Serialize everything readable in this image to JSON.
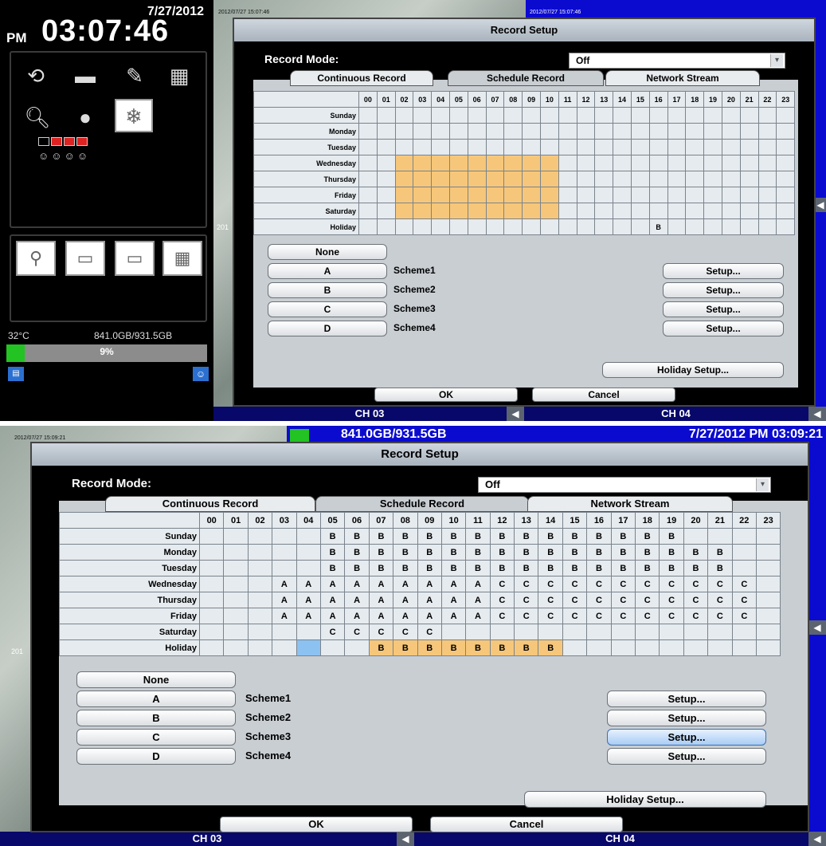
{
  "top": {
    "clock": {
      "date": "7/27/2012",
      "ampm": "PM",
      "time": "03:07:46"
    },
    "left_panel": {
      "icons": [
        "refresh-icon",
        "folder-icon",
        "tools-icon",
        "calendar-search-icon",
        "search-doc-icon",
        "camera-icon",
        "freeze-icon"
      ],
      "hdd_temp": "32°C",
      "hdd_usage": "841.0GB/931.5GB",
      "hdd_percent_label": "9%",
      "hdd_percent": 0.09
    },
    "ch_left": "CH 03",
    "ch_right": "CH 04",
    "cam_timestamp_left": "2012/07/27 15:07:46",
    "cam_timestamp_right": "2012/07/27 15:07:46",
    "cam_small": "201",
    "dialog": {
      "title": "Record Setup",
      "record_mode_label": "Record Mode:",
      "record_mode_value": "Off",
      "tabs": [
        "Continuous Record",
        "Schedule Record",
        "Network Stream"
      ],
      "hours": [
        "00",
        "01",
        "02",
        "03",
        "04",
        "05",
        "06",
        "07",
        "08",
        "09",
        "10",
        "11",
        "12",
        "13",
        "14",
        "15",
        "16",
        "17",
        "18",
        "19",
        "20",
        "21",
        "22",
        "23"
      ],
      "days": [
        "Sunday",
        "Monday",
        "Tuesday",
        "Wednesday",
        "Thursday",
        "Friday",
        "Saturday",
        "Holiday"
      ],
      "grid": [
        "........................",
        "........................",
        "........................",
        "..OOOOOOOOO.............",
        "..OOOOOOOOO.............",
        "..OOOOOOOOO.............",
        "..OOOOOOOOO.............",
        "................B......."
      ],
      "none_label": "None",
      "schemes": [
        {
          "key": "A",
          "name": "Scheme1"
        },
        {
          "key": "B",
          "name": "Scheme2"
        },
        {
          "key": "C",
          "name": "Scheme3"
        },
        {
          "key": "D",
          "name": "Scheme4"
        }
      ],
      "setup_label": "Setup...",
      "holiday_setup": "Holiday Setup...",
      "ok": "OK",
      "cancel": "Cancel"
    }
  },
  "bottom": {
    "header_left": "2012/07/27 15:09:21",
    "hdd_usage": "841.0GB/931.5GB",
    "datetime": "7/27/2012 PM 03:09:21",
    "ch_left": "CH 03",
    "ch_right": "CH 04",
    "cam_small": "201",
    "dialog": {
      "title": "Record Setup",
      "record_mode_label": "Record Mode:",
      "record_mode_value": "Off",
      "tabs": [
        "Continuous Record",
        "Schedule Record",
        "Network Stream"
      ],
      "hours": [
        "00",
        "01",
        "02",
        "03",
        "04",
        "05",
        "06",
        "07",
        "08",
        "09",
        "10",
        "11",
        "12",
        "13",
        "14",
        "15",
        "16",
        "17",
        "18",
        "19",
        "20",
        "21",
        "22",
        "23"
      ],
      "days": [
        "Sunday",
        "Monday",
        "Tuesday",
        "Wednesday",
        "Thursday",
        "Friday",
        "Saturday",
        "Holiday"
      ],
      "grid": [
        ".....BBBBBBBBBBBBBBB....",
        ".....BBBBBBBBBBBBBBBBB..",
        ".....BBBBBBBBBBBBBBBBB..",
        "...AAAAAAAAACCCCCCCCCCC.",
        "...AAAAAAAAACCCCCCCCCCC.",
        "...AAAAAAAAACCCCCCCCCCC.",
        ".....CCCCC..............",
        "....b..BBBBBBBB........."
      ],
      "none_label": "None",
      "schemes": [
        {
          "key": "A",
          "name": "Scheme1"
        },
        {
          "key": "B",
          "name": "Scheme2"
        },
        {
          "key": "C",
          "name": "Scheme3"
        },
        {
          "key": "D",
          "name": "Scheme4"
        }
      ],
      "setup_label": "Setup...",
      "holiday_setup": "Holiday Setup...",
      "ok": "OK",
      "cancel": "Cancel",
      "selected_setup_index": 2
    }
  }
}
